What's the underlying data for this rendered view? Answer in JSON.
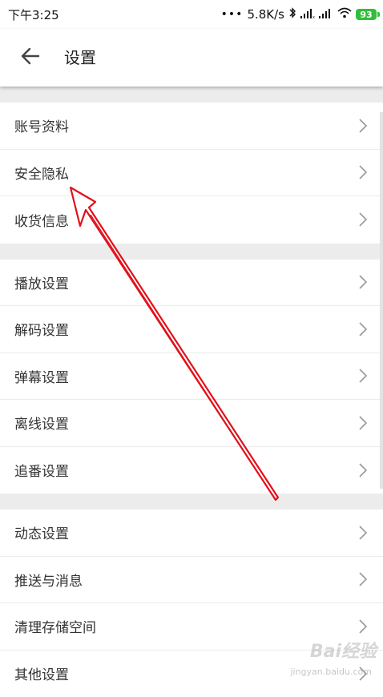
{
  "status_bar": {
    "time": "下午3:25",
    "network_dots": "•••",
    "speed": "5.8K/s",
    "battery": "93"
  },
  "header": {
    "title": "设置"
  },
  "sections": [
    {
      "items": [
        {
          "label": "账号资料"
        },
        {
          "label": "安全隐私"
        },
        {
          "label": "收货信息"
        }
      ]
    },
    {
      "items": [
        {
          "label": "播放设置"
        },
        {
          "label": "解码设置"
        },
        {
          "label": "弹幕设置"
        },
        {
          "label": "离线设置"
        },
        {
          "label": "追番设置"
        }
      ]
    },
    {
      "items": [
        {
          "label": "动态设置"
        },
        {
          "label": "推送与消息"
        },
        {
          "label": "清理存储空间"
        },
        {
          "label": "其他设置"
        }
      ]
    }
  ],
  "watermark": {
    "brand": "Bai经验",
    "url": "jingyan.baidu.com"
  },
  "colors": {
    "annotation_arrow": "#e0121b",
    "battery": "#2fbf3a",
    "section_gap": "#ececec"
  }
}
